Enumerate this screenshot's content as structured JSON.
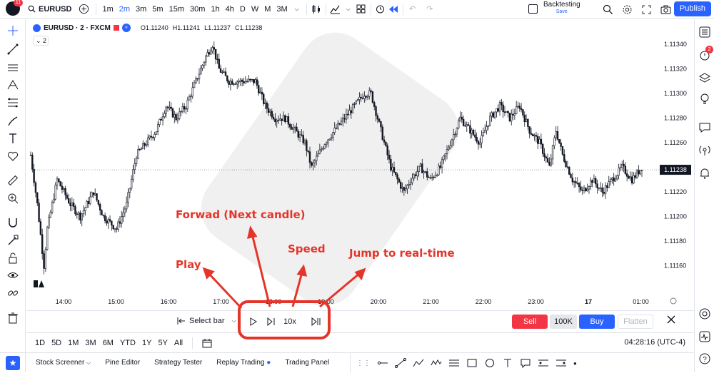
{
  "header": {
    "avatar_badge": "11",
    "symbol": "EURUSD",
    "timeframes": [
      "1m",
      "2m",
      "3m",
      "5m",
      "15m",
      "30m",
      "1h",
      "4h",
      "D",
      "W",
      "M",
      "3M"
    ],
    "active_timeframe": "2m",
    "backtesting_label": "Backtesting",
    "backtesting_sub": "Save",
    "publish_label": "Publish"
  },
  "legend": {
    "symbol": "EURUSD · 2 · FXCM",
    "open": "O1.11240",
    "high": "H1.11241",
    "low": "L1.11237",
    "close": "C1.11238",
    "indicator_count": "2"
  },
  "chart_data": {
    "type": "candlestick",
    "symbol": "EURUSD",
    "ylim": [
      1.1114,
      1.1135
    ],
    "price_ticks": [
      "1.11340",
      "1.11320",
      "1.11300",
      "1.11280",
      "1.11260",
      "1.11240",
      "1.11220",
      "1.11200",
      "1.11180",
      "1.11160"
    ],
    "time_ticks": [
      "14:00",
      "15:00",
      "16:00",
      "17:00",
      "18:00",
      "19:00",
      "20:00",
      "21:00",
      "22:00",
      "23:00",
      "17",
      "01:00"
    ],
    "current_price_label": "1.11238",
    "price_path": [
      [
        0,
        1.1125
      ],
      [
        4,
        1.1121
      ],
      [
        8,
        1.1116
      ],
      [
        10,
        1.1119
      ],
      [
        13,
        1.1121
      ],
      [
        16,
        1.1123
      ],
      [
        20,
        1.1122
      ],
      [
        24,
        1.1121
      ],
      [
        30,
        1.112
      ],
      [
        38,
        1.1122
      ],
      [
        44,
        1.112
      ],
      [
        52,
        1.1119
      ],
      [
        58,
        1.1121
      ],
      [
        64,
        1.1125
      ],
      [
        70,
        1.1126
      ],
      [
        76,
        1.1127
      ],
      [
        82,
        1.1129
      ],
      [
        88,
        1.1128
      ],
      [
        94,
        1.1129
      ],
      [
        100,
        1.1131
      ],
      [
        106,
        1.1133
      ],
      [
        110,
        1.1134
      ],
      [
        114,
        1.1132
      ],
      [
        120,
        1.1131
      ],
      [
        128,
        1.1131
      ],
      [
        136,
        1.1131
      ],
      [
        142,
        1.1129
      ],
      [
        148,
        1.1128
      ],
      [
        154,
        1.1128
      ],
      [
        160,
        1.1127
      ],
      [
        166,
        1.1126
      ],
      [
        170,
        1.1124
      ],
      [
        174,
        1.1125
      ],
      [
        178,
        1.1126
      ],
      [
        184,
        1.1127
      ],
      [
        190,
        1.1128
      ],
      [
        196,
        1.1129
      ],
      [
        202,
        1.113
      ],
      [
        206,
        1.113
      ],
      [
        210,
        1.1128
      ],
      [
        214,
        1.1126
      ],
      [
        218,
        1.1124
      ],
      [
        222,
        1.1123
      ],
      [
        226,
        1.1122
      ],
      [
        230,
        1.1123
      ],
      [
        236,
        1.1124
      ],
      [
        242,
        1.1123
      ],
      [
        248,
        1.1124
      ],
      [
        254,
        1.1126
      ],
      [
        260,
        1.1128
      ],
      [
        266,
        1.1127
      ],
      [
        272,
        1.1126
      ],
      [
        278,
        1.1128
      ],
      [
        284,
        1.1129
      ],
      [
        290,
        1.1128
      ],
      [
        296,
        1.1129
      ],
      [
        302,
        1.1127
      ],
      [
        308,
        1.1126
      ],
      [
        314,
        1.1124
      ],
      [
        318,
        1.1127
      ],
      [
        322,
        1.1125
      ],
      [
        328,
        1.1123
      ],
      [
        334,
        1.1122
      ],
      [
        340,
        1.1123
      ],
      [
        346,
        1.1122
      ],
      [
        352,
        1.1123
      ],
      [
        358,
        1.1124
      ],
      [
        364,
        1.1123
      ],
      [
        370,
        1.1124
      ]
    ],
    "price_path_units": "x = candle index (2-minute bars, 14:00 ≈ index 23), y = price"
  },
  "controlbar": {
    "select_bar": "Select bar",
    "speed": "10x",
    "sell": "Sell",
    "quantity": "100K",
    "buy": "Buy",
    "flatten": "Flatten"
  },
  "rangebar": {
    "ranges": [
      "1D",
      "5D",
      "1M",
      "3M",
      "6M",
      "YTD",
      "1Y",
      "5Y",
      "All"
    ],
    "clock": "04:28:16 (UTC-4)"
  },
  "bottombar": {
    "tabs": [
      "Stock Screener",
      "Pine Editor",
      "Strategy Tester",
      "Replay Trading",
      "Trading Panel"
    ]
  },
  "right_badge": "2",
  "annotations": {
    "forward": "Forwad (Next candle)",
    "speed": "Speed",
    "play": "Play",
    "jump": "Jump to real-time",
    "color": "#e5352a"
  }
}
